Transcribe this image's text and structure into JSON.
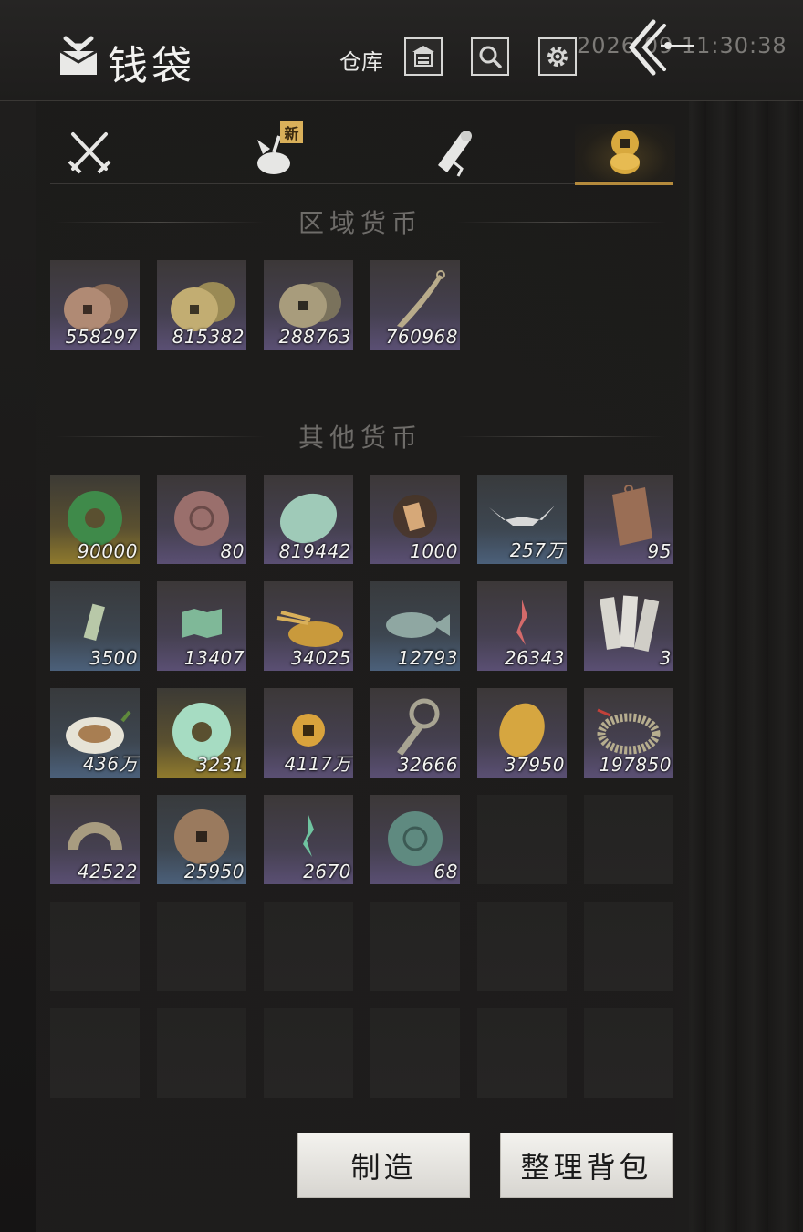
{
  "header": {
    "clock": "2026  09 11:30:38",
    "title": "钱袋",
    "warehouse_label": "仓库",
    "icons": [
      "money-bag-icon",
      "warehouse-icon",
      "search-icon",
      "gear-icon",
      "back-arrow-icon"
    ]
  },
  "tabs": [
    {
      "name": "equipment",
      "icon": "crossed-swords-icon",
      "active": false
    },
    {
      "name": "bag",
      "icon": "cloth-bundle-icon",
      "active": false,
      "badge": "新"
    },
    {
      "name": "scrolls",
      "icon": "scroll-icon",
      "active": false
    },
    {
      "name": "currency",
      "icon": "coins-icon",
      "active": true
    }
  ],
  "regional": {
    "title": "区域货币",
    "items": [
      {
        "icon": "copper-coins-icon",
        "count": "558297",
        "rarity": "purple"
      },
      {
        "icon": "gold-coins-icon",
        "count": "815382",
        "rarity": "purple"
      },
      {
        "icon": "bronze-coins-icon",
        "count": "288763",
        "rarity": "purple"
      },
      {
        "icon": "feather-blade-icon",
        "count": "760968",
        "rarity": "purple"
      }
    ]
  },
  "other": {
    "title": "其他货币",
    "items": [
      {
        "icon": "green-jade-disc-icon",
        "count": "90000",
        "rarity": "gold"
      },
      {
        "icon": "red-stone-disc-icon",
        "count": "80",
        "rarity": "purple"
      },
      {
        "icon": "pale-jade-stone-icon",
        "count": "819442",
        "rarity": "purple"
      },
      {
        "icon": "paper-roll-icon",
        "count": "1000",
        "rarity": "purple"
      },
      {
        "icon": "silver-ingot-icon",
        "count": "257万",
        "rarity": "blue"
      },
      {
        "icon": "bronze-token-icon",
        "count": "95",
        "rarity": "purple"
      },
      {
        "icon": "bamboo-tag-icon",
        "count": "3500",
        "rarity": "blue"
      },
      {
        "icon": "green-map-icon",
        "count": "13407",
        "rarity": "purple"
      },
      {
        "icon": "grain-pile-icon",
        "count": "34025",
        "rarity": "purple"
      },
      {
        "icon": "fish-icon",
        "count": "12793",
        "rarity": "blue"
      },
      {
        "icon": "red-sigil-icon",
        "count": "26343",
        "rarity": "purple"
      },
      {
        "icon": "paper-slips-icon",
        "count": "3",
        "rarity": "purple"
      },
      {
        "icon": "melon-icon",
        "count": "436万",
        "rarity": "blue"
      },
      {
        "icon": "pale-jade-disc-icon",
        "count": "3231",
        "rarity": "gold"
      },
      {
        "icon": "gold-square-coin-icon",
        "count": "4117万",
        "rarity": "purple"
      },
      {
        "icon": "key-coin-icon",
        "count": "32666",
        "rarity": "purple"
      },
      {
        "icon": "gold-nugget-icon",
        "count": "37950",
        "rarity": "purple"
      },
      {
        "icon": "coin-string-icon",
        "count": "197850",
        "rarity": "purple"
      },
      {
        "icon": "half-coin-icon",
        "count": "42522",
        "rarity": "purple"
      },
      {
        "icon": "ancient-coin-icon",
        "count": "25950",
        "rarity": "blue"
      },
      {
        "icon": "green-sigil-icon",
        "count": "2670",
        "rarity": "purple"
      },
      {
        "icon": "teal-stone-disc-icon",
        "count": "68",
        "rarity": "purple"
      }
    ]
  },
  "buttons": {
    "craft": "制造",
    "sort": "整理背包"
  }
}
